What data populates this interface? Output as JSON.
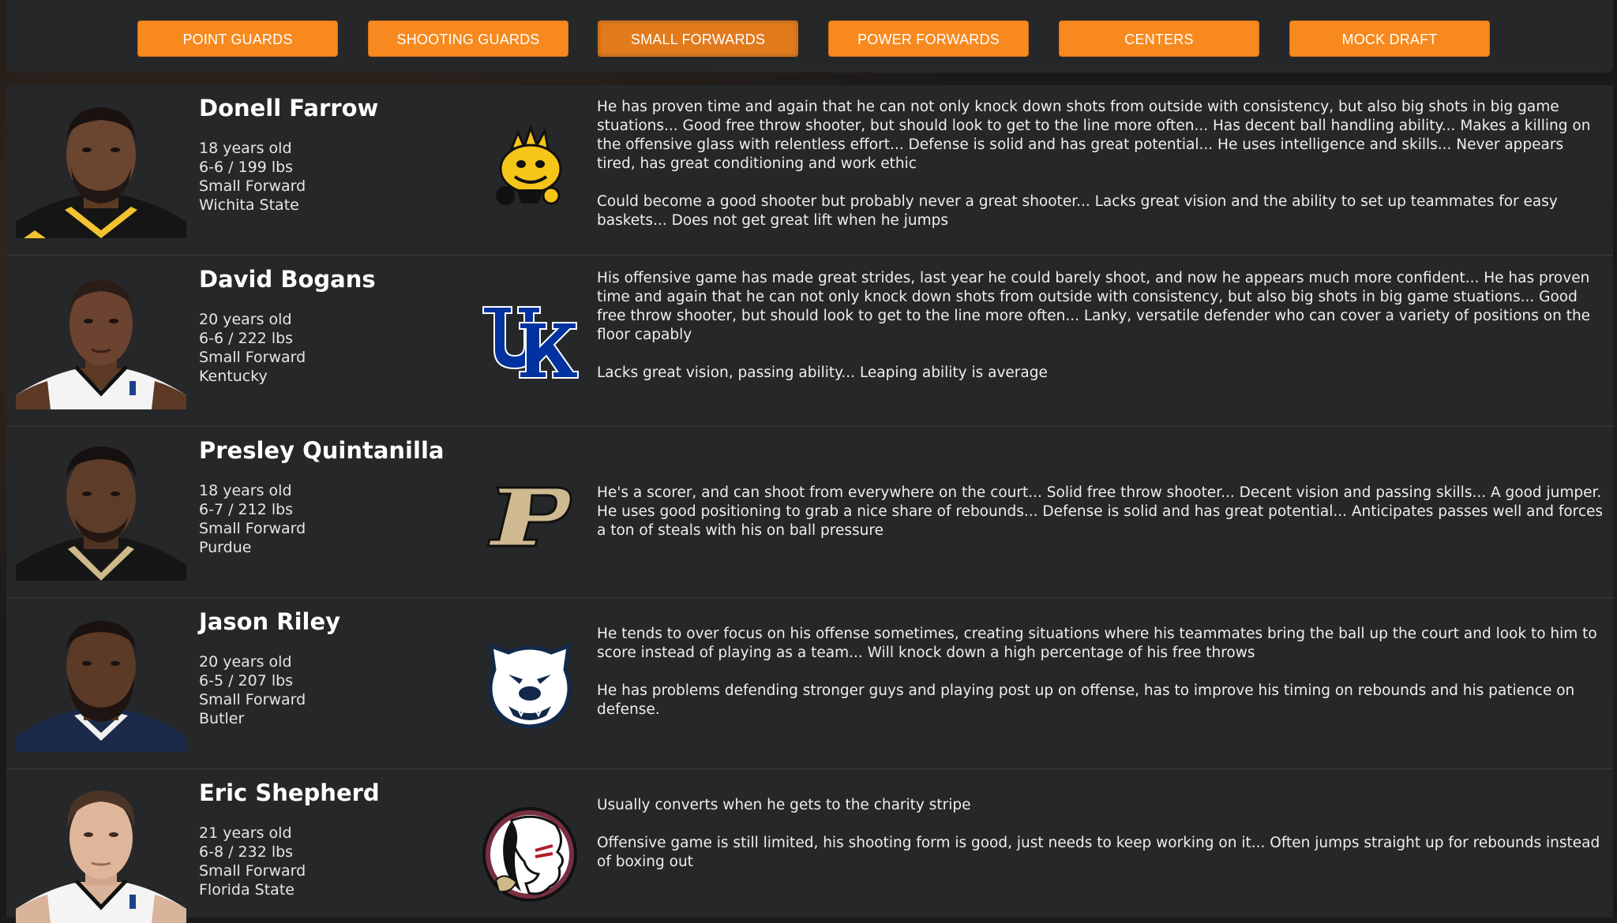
{
  "nav": {
    "buttons": [
      "POINT GUARDS",
      "SHOOTING GUARDS",
      "SMALL FORWARDS",
      "POWER FORWARDS",
      "CENTERS",
      "MOCK DRAFT"
    ],
    "active": "SMALL FORWARDS"
  },
  "players": [
    {
      "name": "Donell Farrow",
      "age": "18 years old",
      "size": "6-6 / 199 lbs",
      "position": "Small Forward",
      "school": "Wichita State",
      "logo_icon": "wichita-state-shocker-logo-icon",
      "strengths": "He has proven time and again that he can not only knock down shots from outside with consistency, but also big shots in big game stuations... Good free throw shooter, but should look to get to the line more often... Has decent ball handling ability... Makes a killing on the offensive glass with relentless effort... Defense is solid and has great potential... He uses intelligence and skills... Never appears tired, has great conditioning and work ethic",
      "weaknesses": "Could become a good shooter but probably never a great shooter... Lacks great vision and the ability to set up teammates for easy baskets... Does not get great lift when he jumps"
    },
    {
      "name": "David Bogans",
      "age": "20 years old",
      "size": "6-6 / 222 lbs",
      "position": "Small Forward",
      "school": "Kentucky",
      "logo_icon": "kentucky-uk-logo-icon",
      "strengths": "His offensive game has made great strides, last year he could barely shoot, and now he appears much more confident... He has proven time and again that he can not only knock down shots from outside with consistency, but also big shots in big game stuations... Good free throw shooter, but should look to get to the line more often... Lanky, versatile defender who can cover a variety of positions on the floor capably",
      "weaknesses": "Lacks great vision, passing ability... Leaping ability is average"
    },
    {
      "name": "Presley Quintanilla",
      "age": "18 years old",
      "size": "6-7 / 212 lbs",
      "position": "Small Forward",
      "school": "Purdue",
      "logo_icon": "purdue-p-logo-icon",
      "strengths": "He's a scorer, and can shoot from everywhere on the court... Solid free throw shooter... Decent vision and passing skills... A good jumper. He uses good positioning to grab a nice share of rebounds... Defense is solid and has great potential... Anticipates passes well and forces a ton of steals with his on ball pressure",
      "weaknesses": ""
    },
    {
      "name": "Jason Riley",
      "age": "20 years old",
      "size": "6-5 / 207 lbs",
      "position": "Small Forward",
      "school": "Butler",
      "logo_icon": "butler-bulldog-logo-icon",
      "strengths": "He tends to over focus on his offense sometimes, creating situations where his teammates bring the ball up the court and look to him to score instead of playing as a team... Will knock down a high percentage of his free throws",
      "weaknesses": "He has problems defending stronger guys and playing post up on offense, has to improve his timing on rebounds and his patience on defense."
    },
    {
      "name": "Eric Shepherd",
      "age": "21 years old",
      "size": "6-8 / 232 lbs",
      "position": "Small Forward",
      "school": "Florida State",
      "logo_icon": "florida-state-seminole-logo-icon",
      "strengths": "Usually converts when he gets to the charity stripe",
      "weaknesses": "Offensive game is still limited, his shooting form is good, just needs to keep working on it... Often jumps straight up for rebounds instead of boxing out"
    }
  ],
  "colors": {
    "accent": "#f7891f",
    "panel": "#262728",
    "background": "#1b1b1c"
  }
}
